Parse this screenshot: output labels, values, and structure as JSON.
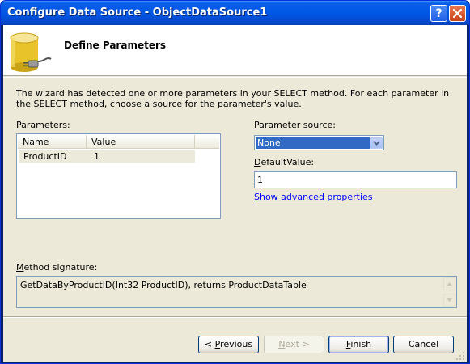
{
  "window": {
    "title": "Configure Data Source - ObjectDataSource1",
    "help_glyph": "?"
  },
  "header": {
    "title": "Define Parameters"
  },
  "description": "The wizard has detected one or more parameters in your SELECT method. For each parameter in the SELECT method, choose a source for the parameter's value.",
  "parameters": {
    "label_before": "Param",
    "label_underlined": "e",
    "label_after": "ters:",
    "columns": [
      "Name",
      "Value"
    ],
    "rows": [
      {
        "name": "ProductID",
        "value": "1"
      }
    ]
  },
  "parameter_source": {
    "label_before": "Parameter ",
    "label_underlined": "s",
    "label_after": "ource:",
    "selected": "None"
  },
  "default_value": {
    "label_underlined": "D",
    "label_after": "efaultValue:",
    "value": "1"
  },
  "advanced_link": "Show advanced properties",
  "method_signature": {
    "label_underlined": "M",
    "label_after": "ethod signature:",
    "value": "GetDataByProductID(Int32 ProductID), returns ProductDataTable"
  },
  "buttons": {
    "previous_before": "< ",
    "previous_underlined": "P",
    "previous_after": "revious",
    "next_before": "",
    "next_underlined": "N",
    "next_after": "ext >",
    "finish_underlined": "F",
    "finish_after": "inish",
    "cancel": "Cancel"
  },
  "colors": {
    "titlebar": "#0058e6",
    "dialog_bg": "#ece9d8",
    "selection": "#316ac5",
    "link": "#0000ff"
  }
}
